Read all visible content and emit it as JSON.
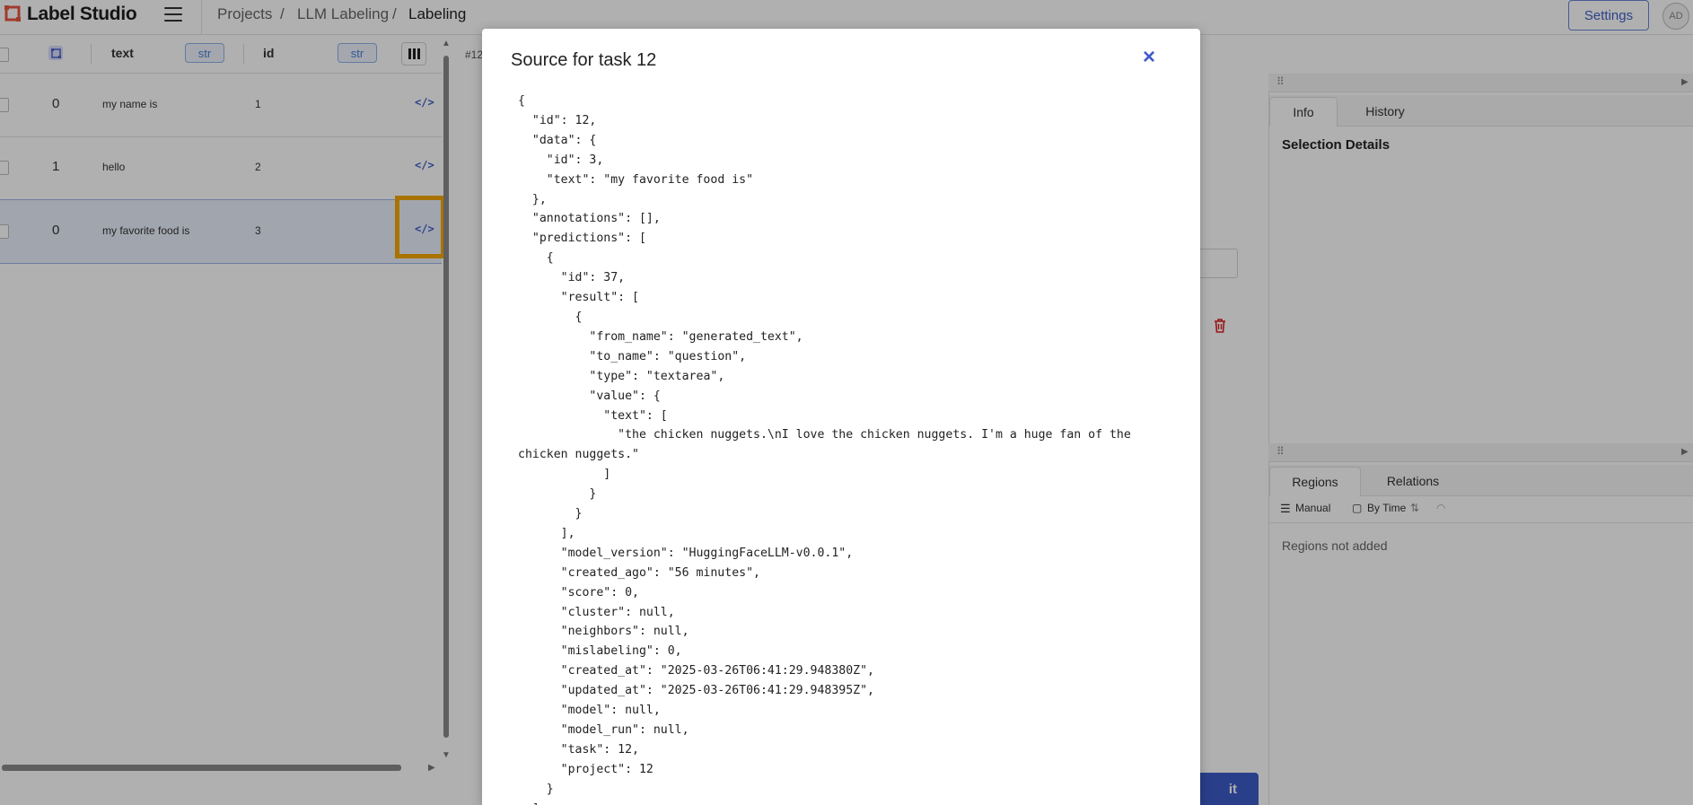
{
  "app": {
    "name": "Label Studio",
    "avatar_initials": "AD",
    "accent_color": "#3d5cc9",
    "highlight_color": "#f5a700"
  },
  "breadcrumbs": [
    "Projects",
    "/",
    "LLM Labeling",
    "/",
    "Labeling"
  ],
  "header": {
    "settings_label": "Settings"
  },
  "table": {
    "columns": [
      {
        "label": "text",
        "type": "str"
      },
      {
        "label": "id",
        "type": "str"
      }
    ],
    "rows": [
      {
        "count": "0",
        "text": "my name is",
        "id": "1",
        "selected": false
      },
      {
        "count": "1",
        "text": "hello",
        "id": "2",
        "selected": false
      },
      {
        "count": "0",
        "text": "my favorite food is",
        "id": "3",
        "selected": true
      }
    ],
    "code_icon": "</>"
  },
  "main": {
    "task_tab": "#12",
    "submit_label": "it"
  },
  "info_panel": {
    "tabs": [
      "Info",
      "History"
    ],
    "active_tab": "Info",
    "selection_details": "Selection Details"
  },
  "regions_panel": {
    "tabs": [
      "Regions",
      "Relations"
    ],
    "active_tab": "Regions",
    "toolbar": {
      "manual": "Manual",
      "by_time": "By Time"
    },
    "empty_text": "Regions not added"
  },
  "modal": {
    "title": "Source for task 12",
    "close_icon": "×",
    "source": "{\n  \"id\": 12,\n  \"data\": {\n    \"id\": 3,\n    \"text\": \"my favorite food is\"\n  },\n  \"annotations\": [],\n  \"predictions\": [\n    {\n      \"id\": 37,\n      \"result\": [\n        {\n          \"from_name\": \"generated_text\",\n          \"to_name\": \"question\",\n          \"type\": \"textarea\",\n          \"value\": {\n            \"text\": [\n              \"the chicken nuggets.\\nI love the chicken nuggets. I'm a huge fan of the chicken nuggets.\"\n            ]\n          }\n        }\n      ],\n      \"model_version\": \"HuggingFaceLLM-v0.0.1\",\n      \"created_ago\": \"56 minutes\",\n      \"score\": 0,\n      \"cluster\": null,\n      \"neighbors\": null,\n      \"mislabeling\": 0,\n      \"created_at\": \"2025-03-26T06:41:29.948380Z\",\n      \"updated_at\": \"2025-03-26T06:41:29.948395Z\",\n      \"model\": null,\n      \"model_run\": null,\n      \"task\": 12,\n      \"project\": 12\n    }\n  ]\n}"
  }
}
